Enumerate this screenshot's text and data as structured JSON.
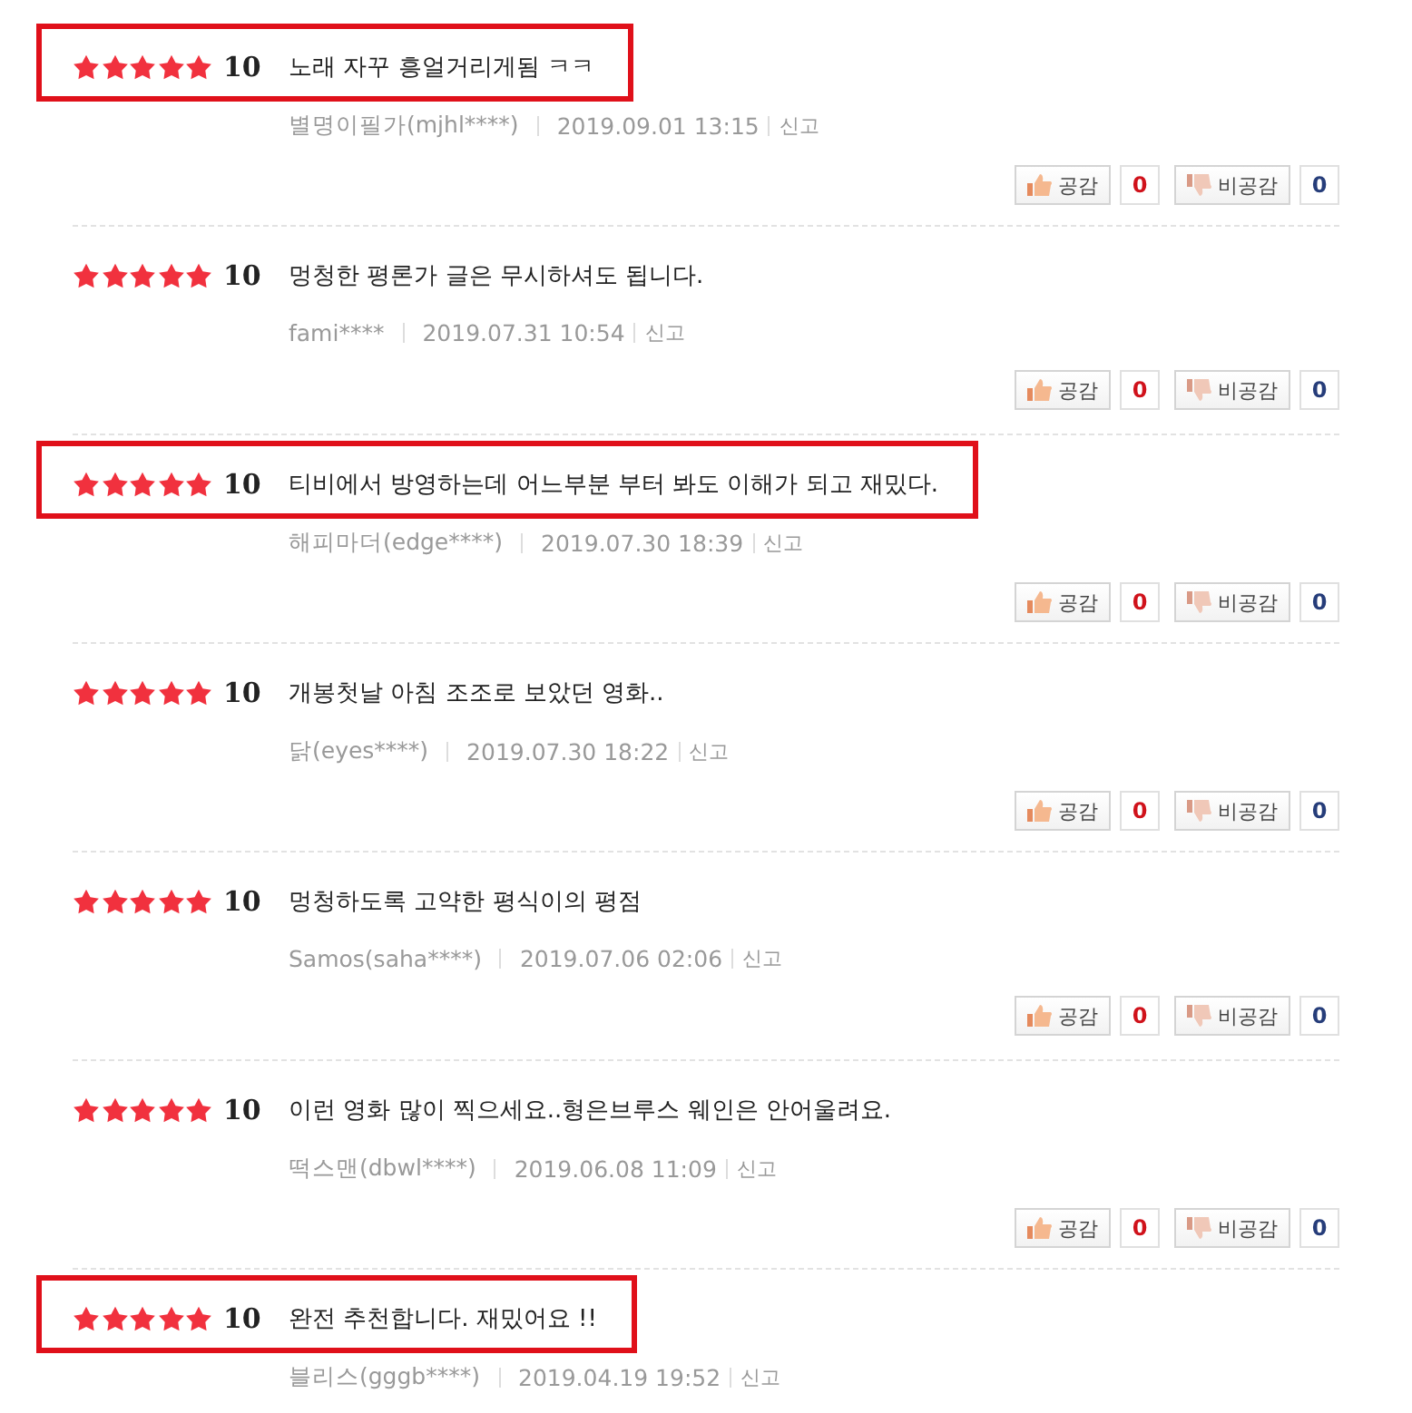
{
  "reviews": [
    {
      "stars": 5,
      "score": "10",
      "text": "노래 자꾸 흥얼거리게됨 ㅋㅋ",
      "author": "별명이필가(mjhl****)",
      "date": "2019.09.01 13:15",
      "report": "신고",
      "highlighted": true,
      "votes": {
        "like_label": "공감",
        "like_count": "0",
        "dislike_label": "비공감",
        "dislike_count": "0"
      }
    },
    {
      "stars": 5,
      "score": "10",
      "text": "멍청한 평론가 글은 무시하셔도 됩니다.",
      "author": "fami****",
      "date": "2019.07.31 10:54",
      "report": "신고",
      "highlighted": false,
      "votes": {
        "like_label": "공감",
        "like_count": "0",
        "dislike_label": "비공감",
        "dislike_count": "0"
      }
    },
    {
      "stars": 5,
      "score": "10",
      "text": "티비에서 방영하는데 어느부분 부터 봐도 이해가 되고 재밌다.",
      "author": "해피마더(edge****)",
      "date": "2019.07.30 18:39",
      "report": "신고",
      "highlighted": true,
      "votes": {
        "like_label": "공감",
        "like_count": "0",
        "dislike_label": "비공감",
        "dislike_count": "0"
      }
    },
    {
      "stars": 5,
      "score": "10",
      "text": "개봉첫날 아침 조조로 보았던 영화..",
      "author": "닭(eyes****)",
      "date": "2019.07.30 18:22",
      "report": "신고",
      "highlighted": false,
      "votes": {
        "like_label": "공감",
        "like_count": "0",
        "dislike_label": "비공감",
        "dislike_count": "0"
      }
    },
    {
      "stars": 5,
      "score": "10",
      "text": "멍청하도록 고약한 평식이의 평점",
      "author": "Samos(saha****)",
      "date": "2019.07.06 02:06",
      "report": "신고",
      "highlighted": false,
      "votes": {
        "like_label": "공감",
        "like_count": "0",
        "dislike_label": "비공감",
        "dislike_count": "0"
      }
    },
    {
      "stars": 5,
      "score": "10",
      "text": "이런 영화 많이 찍으세요..형은브루스 웨인은 안어울려요.",
      "author": "떡스맨(dbwl****)",
      "date": "2019.06.08 11:09",
      "report": "신고",
      "highlighted": false,
      "votes": {
        "like_label": "공감",
        "like_count": "0",
        "dislike_label": "비공감",
        "dislike_count": "0"
      }
    },
    {
      "stars": 5,
      "score": "10",
      "text": "완전 추천합니다. 재밌어요 !!",
      "author": "블리스(gggb****)",
      "date": "2019.04.19 19:52",
      "report": "신고",
      "highlighted": true
    }
  ]
}
